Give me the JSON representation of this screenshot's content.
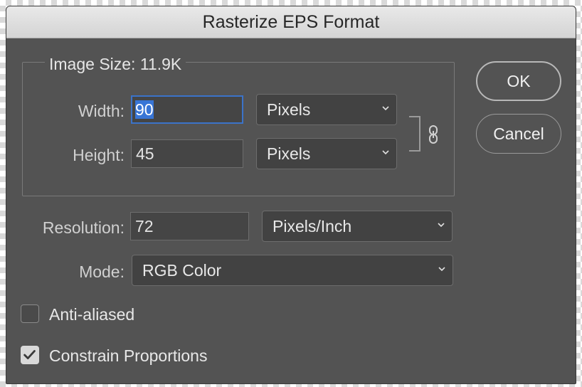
{
  "window": {
    "title": "Rasterize EPS Format"
  },
  "image_size": {
    "legend": "Image Size: 11.9K",
    "width_label": "Width:",
    "width_value": "90",
    "width_unit": "Pixels",
    "height_label": "Height:",
    "height_value": "45",
    "height_unit": "Pixels",
    "constrain_link_icon": "chain-link-icon"
  },
  "resolution": {
    "label": "Resolution:",
    "value": "72",
    "unit": "Pixels/Inch"
  },
  "mode": {
    "label": "Mode:",
    "value": "RGB Color"
  },
  "options": {
    "anti_aliased": {
      "label": "Anti-aliased",
      "checked": false
    },
    "constrain_proportions": {
      "label": "Constrain Proportions",
      "checked": true
    }
  },
  "buttons": {
    "ok": "OK",
    "cancel": "Cancel"
  },
  "colors": {
    "dialog_bg": "#535353",
    "focus_ring": "#3b73c9",
    "selection": "#3875d6"
  }
}
